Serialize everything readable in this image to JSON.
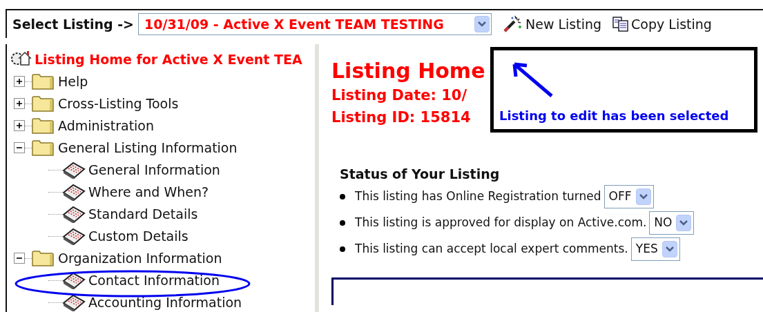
{
  "toolbar": {
    "label": "Select Listing ->",
    "listing_select": {
      "value": "10/31/09 - Active X Event TEAM TESTING"
    },
    "buttons": [
      {
        "kind": "new",
        "label": "New Listing"
      },
      {
        "kind": "copy",
        "label": "Copy Listing"
      }
    ]
  },
  "tree": {
    "root": "Listing Home for Active X Event TEA",
    "items": [
      {
        "kind": "folder",
        "label": "Help",
        "expanded": false
      },
      {
        "kind": "folder",
        "label": "Cross-Listing Tools",
        "expanded": false
      },
      {
        "kind": "folder",
        "label": "Administration",
        "expanded": false
      },
      {
        "kind": "folder",
        "label": "General Listing Information",
        "expanded": true,
        "children": [
          {
            "kind": "page",
            "label": "General Information"
          },
          {
            "kind": "page",
            "label": "Where and When?"
          },
          {
            "kind": "page",
            "label": "Standard Details"
          },
          {
            "kind": "page",
            "label": "Custom Details"
          }
        ]
      },
      {
        "kind": "folder",
        "label": "Organization Information",
        "expanded": true,
        "children": [
          {
            "kind": "page",
            "label": "Contact Information"
          },
          {
            "kind": "page",
            "label": "Accounting Information"
          }
        ]
      }
    ]
  },
  "content": {
    "title": "Listing Home",
    "date": "Listing Date: 10/",
    "id": "Listing ID: 15814",
    "status": {
      "heading": "Status of Your Listing",
      "items": [
        {
          "text": "This listing has Online Registration turned",
          "value": "OFF"
        },
        {
          "text": "This listing is approved for display on Active.com.",
          "value": "NO"
        },
        {
          "text": "This listing can accept local expert comments.",
          "value": "YES"
        }
      ]
    }
  },
  "callout": {
    "text": "Listing to edit has been selected"
  }
}
